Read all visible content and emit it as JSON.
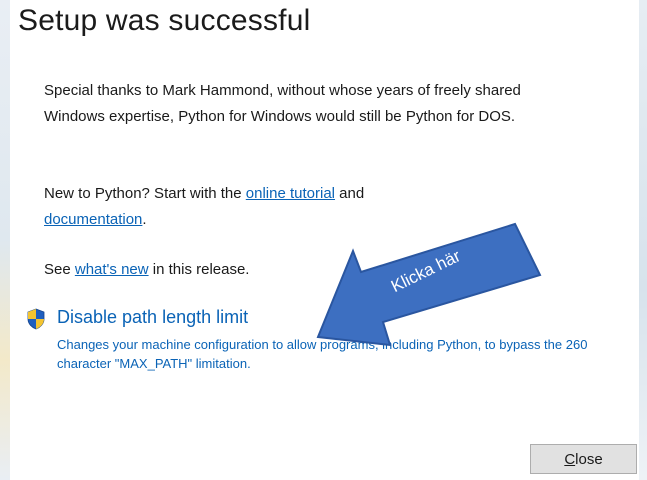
{
  "title": "Setup was successful",
  "thanks": {
    "text": "Special thanks to Mark Hammond, without whose years of freely shared Windows expertise, Python for Windows would still be Python for DOS."
  },
  "new_to_python": {
    "prefix": "New to Python? Start with the ",
    "tutorial_link": "online tutorial",
    "middle": " and",
    "documentation_link": "documentation",
    "suffix": "."
  },
  "whats_new": {
    "prefix": "See ",
    "link": "what's new",
    "suffix": " in this release."
  },
  "path_limit": {
    "icon": "uac-shield-icon",
    "link": "Disable path length limit",
    "description": "Changes your machine configuration to allow programs, including Python, to bypass the 260 character \"MAX_PATH\" limitation."
  },
  "annotation": {
    "label": "Klicka här",
    "color": "#3d6fc1"
  },
  "close_button": {
    "mnemonic": "C",
    "rest": "lose"
  },
  "colors": {
    "link": "#0a63b6",
    "button_bg": "#e1e1e1"
  }
}
